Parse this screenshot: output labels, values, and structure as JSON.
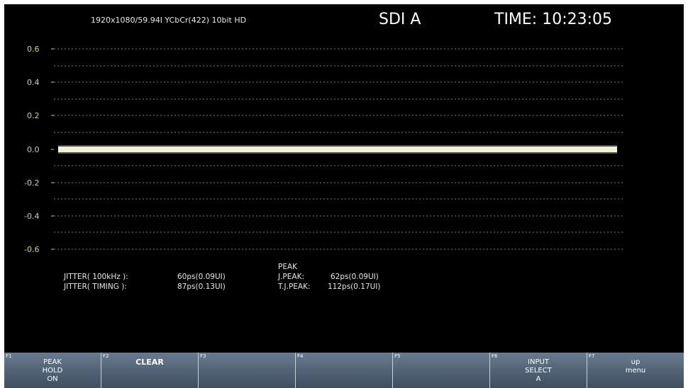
{
  "header": {
    "format": "1920x1080/59.94I YCbCr(422) 10bit HD",
    "input": "SDI A",
    "time": "TIME: 10:23:05"
  },
  "graph": {
    "y_ticks": [
      "0.6",
      "0.4",
      "0.2",
      "0.0",
      "-0.2",
      "-0.4",
      "-0.6"
    ],
    "tick_color": "#d8d27a",
    "trace_color": "#f4f1d6"
  },
  "measurements": {
    "jitter_100khz_label": "JITTER( 100kHz ):",
    "jitter_100khz_value": "60ps(0.09UI)",
    "jitter_timing_label": "JITTER( TIMING ):",
    "jitter_timing_value": "87ps(0.13UI)",
    "peak_heading": "PEAK",
    "j_peak_label": "J.PEAK:",
    "j_peak_value": "62ps(0.09UI)",
    "tj_peak_label": "T.J.PEAK:",
    "tj_peak_value": "112ps(0.17UI)"
  },
  "menu": {
    "keys": [
      {
        "num": "F1",
        "label": "PEAK\nHOLD\nON",
        "bold": false
      },
      {
        "num": "F2",
        "label": "CLEAR",
        "bold": true
      },
      {
        "num": "F3",
        "label": "",
        "bold": false
      },
      {
        "num": "F4",
        "label": "",
        "bold": false
      },
      {
        "num": "F5",
        "label": "",
        "bold": false
      },
      {
        "num": "F6",
        "label": "INPUT\nSELECT\nA",
        "bold": false
      },
      {
        "num": "F7",
        "label": "up\nmenu",
        "bold": false
      }
    ]
  }
}
